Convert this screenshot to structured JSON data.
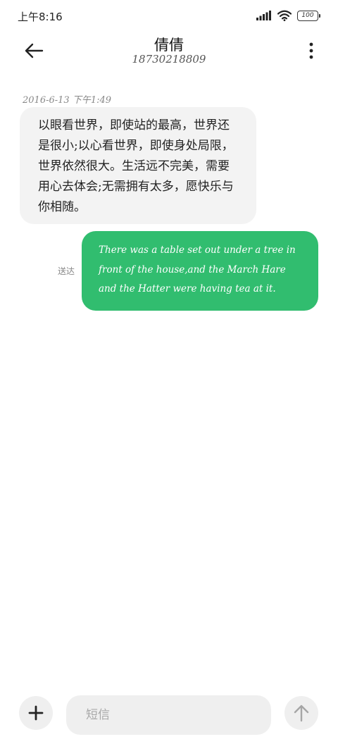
{
  "status_bar": {
    "time": "上午8:16",
    "battery": "100",
    "icons": [
      "signal-icon",
      "wifi-icon",
      "battery-icon"
    ]
  },
  "header": {
    "contact_name": "倩倩",
    "contact_number": "18730218809",
    "back_icon": "arrow-left-icon",
    "more_icon": "more-vertical-icon"
  },
  "conversation": {
    "timestamp": "2016-6-13 下午1:49",
    "messages": [
      {
        "direction": "incoming",
        "text": "以眼看世界，即使站的最高，世界还是很小;以心看世界，即使身处局限，世界依然很大。生活远不完美，需要用心去体会;无需拥有太多，愿快乐与你相随。"
      },
      {
        "direction": "outgoing",
        "text": "There was a table set out under a tree in front of the house,and the March Hare and the Hatter were having tea at it.",
        "status": "送达"
      }
    ]
  },
  "composer": {
    "placeholder": "短信",
    "value": "",
    "attach_icon": "plus-icon",
    "send_icon": "arrow-up-icon"
  },
  "colors": {
    "outgoing_bubble": "#31bd6f",
    "incoming_bubble": "#f3f3f3",
    "input_background": "#efefef"
  }
}
